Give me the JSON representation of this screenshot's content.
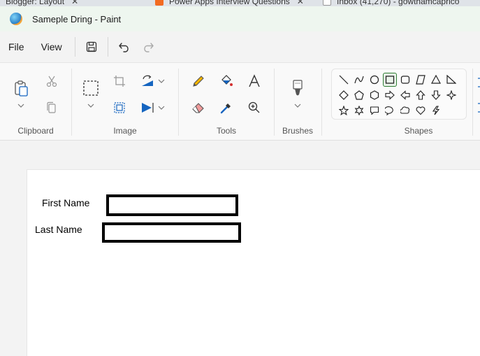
{
  "browser_tabs": [
    {
      "title": "Blogger: Layout"
    },
    {
      "title": "Power Apps Interview Questions"
    },
    {
      "title": "Inbox (41,270) - gowthamcaprico"
    }
  ],
  "window": {
    "title": "Sameple Dring - Paint"
  },
  "menu": {
    "file": "File",
    "view": "View"
  },
  "ribbon": {
    "groups": {
      "clipboard": "Clipboard",
      "image": "Image",
      "tools": "Tools",
      "brushes": "Brushes",
      "shapes": "Shapes"
    }
  },
  "canvas": {
    "first_name_label": "First Name",
    "last_name_label": "Last Name"
  },
  "colors": {
    "titlebar": "#eef6ef",
    "accent": "#2e7d32",
    "select_tool": "#1565c0"
  }
}
